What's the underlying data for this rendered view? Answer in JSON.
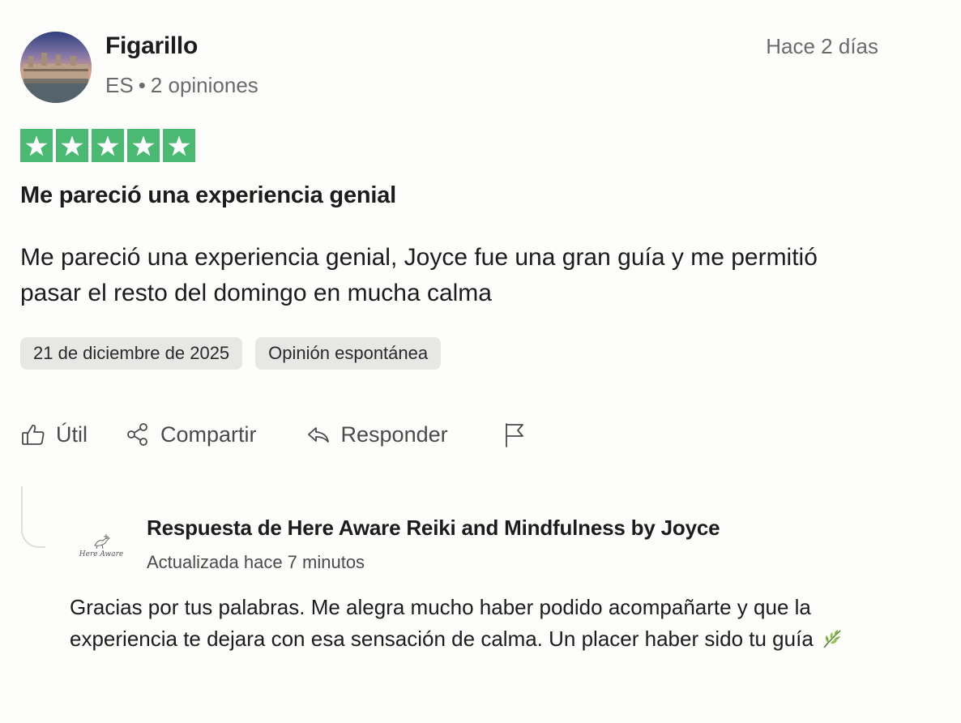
{
  "reviewer": {
    "name": "Figarillo",
    "country": "ES",
    "separator": "•",
    "review_count": "2 opiniones"
  },
  "review": {
    "relative_date": "Hace 2 días",
    "rating": 5,
    "rating_max": 5,
    "star_color": "#4aba73",
    "title": "Me pareció una experiencia genial",
    "body": "Me pareció una experiencia genial, Joyce fue una gran guía y me permitió pasar el resto del domingo en mucha calma",
    "date_chip": "21 de diciembre de 2025",
    "type_chip": "Opinión espontánea"
  },
  "actions": {
    "useful": "Útil",
    "share": "Compartir",
    "reply": "Responder"
  },
  "reply": {
    "logo_text": "Here Aware",
    "title": "Respuesta de Here Aware Reiki and Mindfulness by Joyce",
    "updated": "Actualizada hace 7 minutos",
    "body": "Gracias por tus palabras. Me alegra mucho haber podido acompañarte y que la experiencia te dejara con esa sensación de calma. Un placer haber sido tu guía"
  },
  "icons": {
    "useful": "thumbs-up-icon",
    "share": "share-icon",
    "reply": "reply-arrow-icon",
    "report": "flag-icon",
    "leaf": "herb-emoji"
  }
}
